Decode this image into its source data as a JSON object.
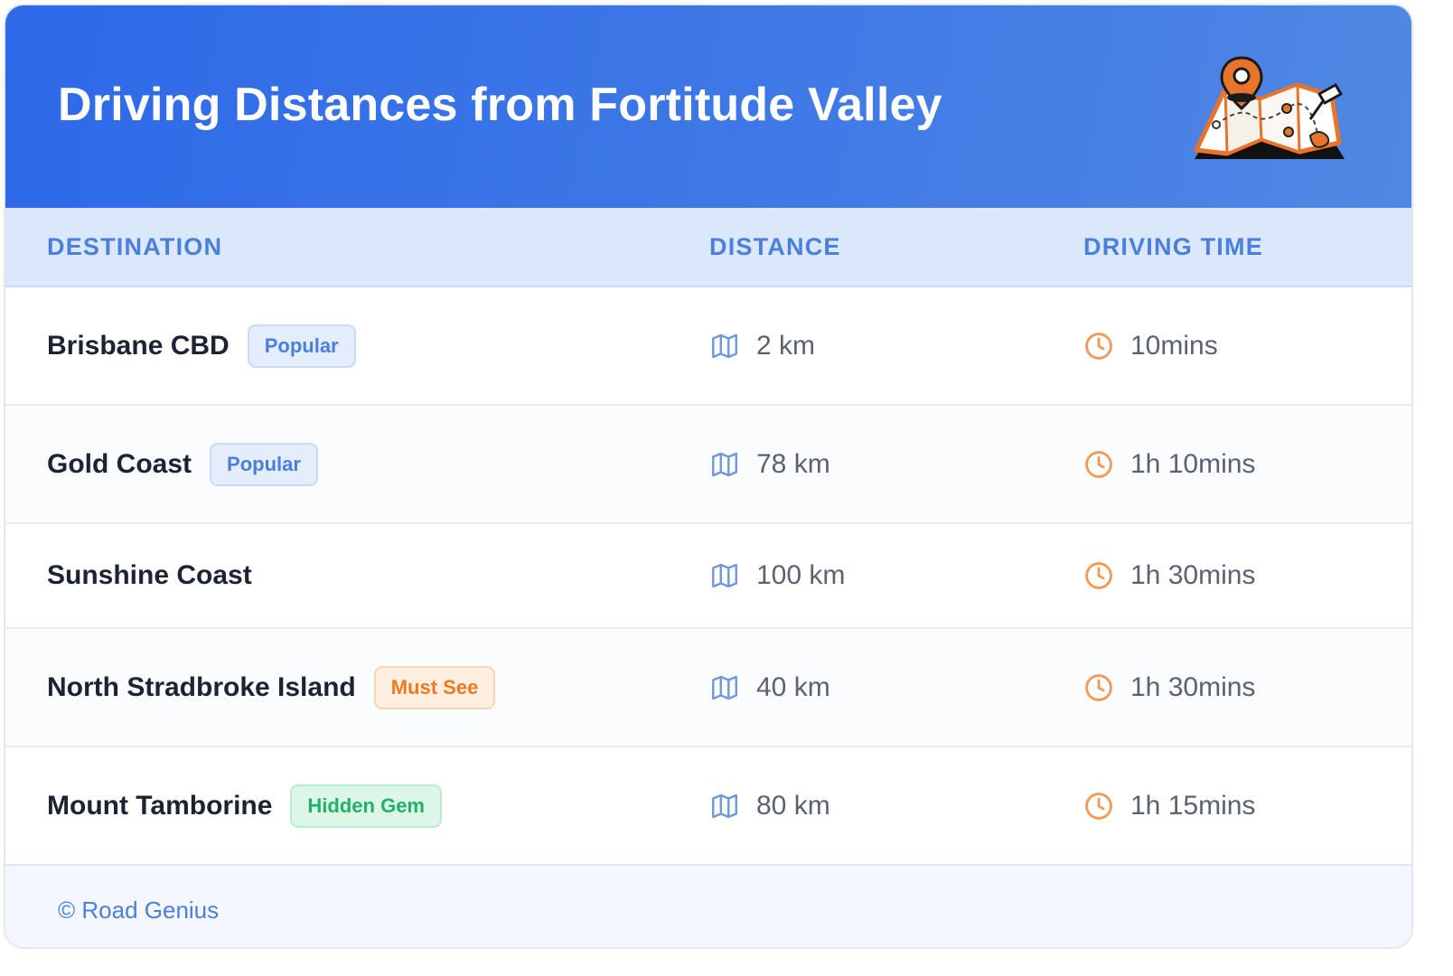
{
  "header": {
    "title": "Driving Distances from Fortitude Valley",
    "illustration_icon": "map-pin-illustration"
  },
  "table": {
    "columns": [
      "DESTINATION",
      "DISTANCE",
      "DRIVING TIME"
    ],
    "rows": [
      {
        "destination": "Brisbane CBD",
        "badge": "Popular",
        "badge_type": "popular",
        "distance": "2 km",
        "time": "10mins"
      },
      {
        "destination": "Gold Coast",
        "badge": "Popular",
        "badge_type": "popular",
        "distance": "78 km",
        "time": "1h 10mins"
      },
      {
        "destination": "Sunshine Coast",
        "badge": "",
        "badge_type": "",
        "distance": "100 km",
        "time": "1h 30mins"
      },
      {
        "destination": "North Stradbroke Island",
        "badge": "Must See",
        "badge_type": "mustsee",
        "distance": "40 km",
        "time": "1h 30mins"
      },
      {
        "destination": "Mount Tamborine",
        "badge": "Hidden Gem",
        "badge_type": "gem",
        "distance": "80 km",
        "time": "1h 15mins"
      }
    ]
  },
  "icons": {
    "distance": "map-icon",
    "time": "clock-icon"
  },
  "footer": {
    "text": "© Road Genius"
  },
  "colors": {
    "header_start": "#2d69e8",
    "header_end": "#5088e3",
    "accent_blue": "#4a7fdc",
    "accent_orange": "#ec7a23",
    "accent_green": "#20b366"
  }
}
